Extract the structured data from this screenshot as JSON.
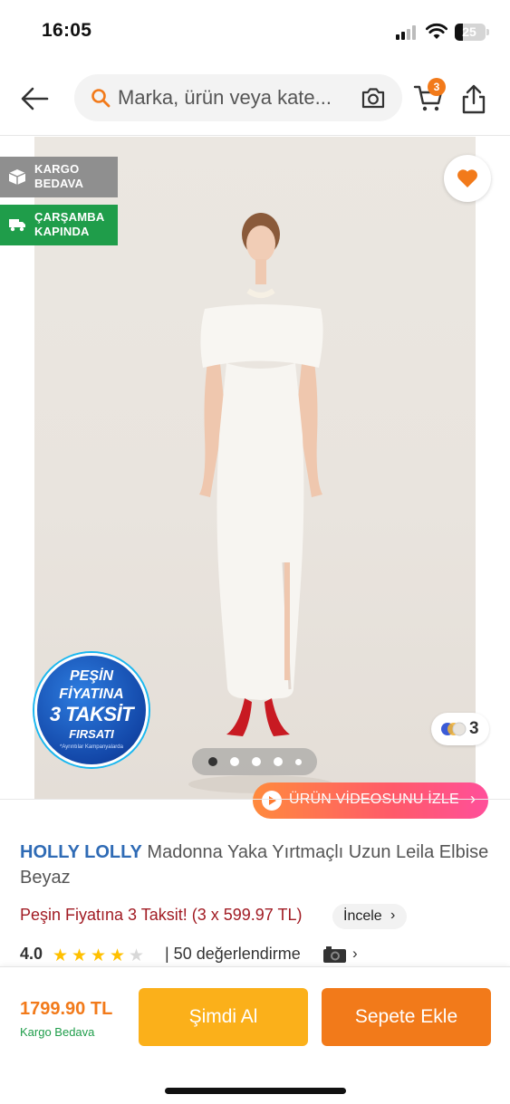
{
  "status_bar": {
    "time": "16:05",
    "battery": "25"
  },
  "header": {
    "back_icon": "arrow-left-icon",
    "search_placeholder": "Marka, ürün veya kate...",
    "search_icon": "search-icon",
    "camera_icon": "camera-icon",
    "cart_count": "3",
    "share_icon": "share-icon"
  },
  "gallery": {
    "badges": [
      {
        "line1": "KARGO",
        "line2": "BEDAVA",
        "color": "#8f8f8f"
      },
      {
        "line1": "ÇARŞAMBA",
        "line2": "KAPINDA",
        "color": "#1f9d4a"
      }
    ],
    "campaign": {
      "line1": "PEŞİN",
      "line2": "FİYATINA",
      "line3": "3 TAKSİT",
      "line4": "FIRSATI",
      "note": "*Ayrıntılar Kampanyalarda"
    },
    "color_count": "3",
    "pagination": {
      "total": 5,
      "active": 1
    },
    "video_label": "ÜRÜN VİDEOSUNU İZLE"
  },
  "product": {
    "brand": "HOLLY LOLLY",
    "name": "Madonna Yaka Yırtmaçlı Uzun Leila Elbise Beyaz",
    "installment": "Peşin Fiyatına 3 Taksit! (3 x 599.97 TL)",
    "installment_link": "İncele",
    "rating": "4.0",
    "stars_filled": 4,
    "stars_total": 5,
    "review_count_text": "| 50 değerlendirme"
  },
  "action_bar": {
    "price": "1799.90 TL",
    "shipping": "Kargo Bedava",
    "buy_now": "Şimdi Al",
    "add_to_cart": "Sepete Ekle"
  },
  "colors": {
    "accent": "#f27a1a",
    "buy_now": "#fbb01a",
    "brand": "#2f6bb5",
    "installment": "#a11b23",
    "success": "#1f9d4a"
  }
}
